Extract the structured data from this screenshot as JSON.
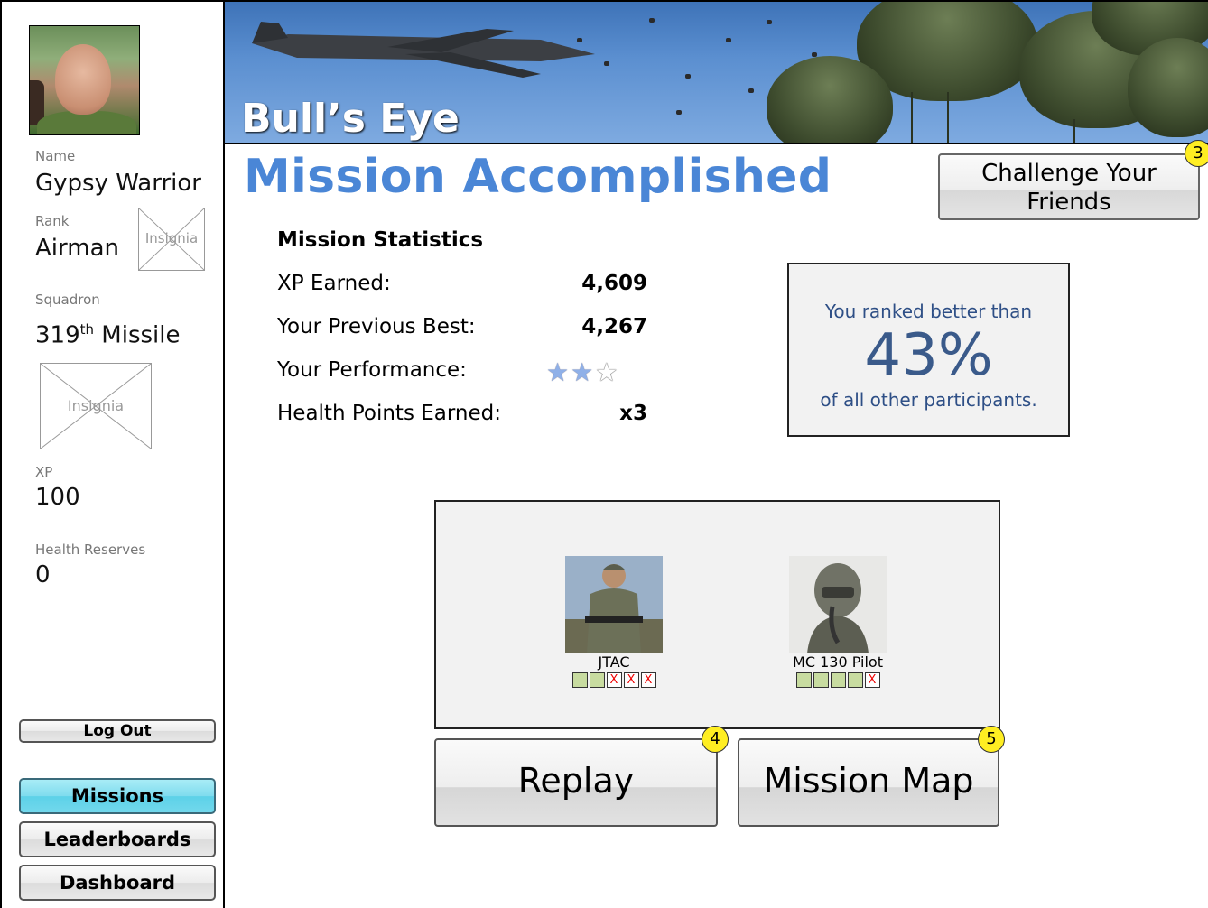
{
  "profile": {
    "name_label": "Name",
    "name": "Gypsy Warrior",
    "rank_label": "Rank",
    "rank": "Airman",
    "rank_insignia": "Insignia",
    "squadron_label": "Squadron",
    "squadron_num": "319",
    "squadron_sup": "th",
    "squadron_name": " Missile",
    "squadron_insignia": "Insignia",
    "xp_label": "XP",
    "xp": "100",
    "health_label": "Health Reserves",
    "health": "0"
  },
  "nav": {
    "logout": "Log Out",
    "missions": "Missions",
    "leaderboards": "Leaderboards",
    "dashboard": "Dashboard"
  },
  "banner": {
    "title": "Bull’s Eye"
  },
  "page": {
    "title": "Mission Accomplished",
    "challenge_line1": "Challenge Your",
    "challenge_line2": "Friends",
    "badge3": "3",
    "badge4": "4",
    "badge5": "5"
  },
  "stats": {
    "heading": "Mission Statistics",
    "xp_label": "XP Earned:",
    "xp_value": "4,609",
    "best_label": "Your Previous Best:",
    "best_value": "4,267",
    "perf_label": "Your Performance:",
    "perf_stars": 2,
    "perf_max": 3,
    "health_label": "Health Points Earned:",
    "health_value": "x3"
  },
  "ranking": {
    "line1": "You ranked better than",
    "percent": "43%",
    "line2": "of all other participants."
  },
  "team": [
    {
      "name": "JTAC",
      "health": [
        true,
        true,
        false,
        false,
        false
      ]
    },
    {
      "name": "MC 130 Pilot",
      "health": [
        true,
        true,
        true,
        true,
        false
      ]
    }
  ],
  "actions": {
    "replay": "Replay",
    "map": "Mission Map"
  }
}
